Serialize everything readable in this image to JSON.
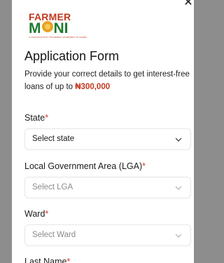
{
  "header": {
    "close_icon": "close-icon",
    "logo": {
      "line1": "FARMER",
      "line2a": "M",
      "line2b": "NI",
      "tagline": "A LOAN INITIATIVE BY THE FEDERAL GOVERNMENT OF NIGERIA"
    }
  },
  "form": {
    "title": "Application Form",
    "subtitle_text": "Provide your correct details to get interest-free loans of up to ",
    "subtitle_amount": "₦300,000",
    "required_marker": "*",
    "fields": [
      {
        "label": "State",
        "placeholder": "Select state",
        "disabled": false
      },
      {
        "label": "Local Government Area (LGA)",
        "placeholder": "Select LGA",
        "disabled": true
      },
      {
        "label": "Ward",
        "placeholder": "Select Ward",
        "disabled": true
      },
      {
        "label": "Last Name"
      }
    ]
  },
  "colors": {
    "accent_red": "#c2381f",
    "brand_green": "#1e7a2f",
    "overlay": "#8d8d8d"
  }
}
